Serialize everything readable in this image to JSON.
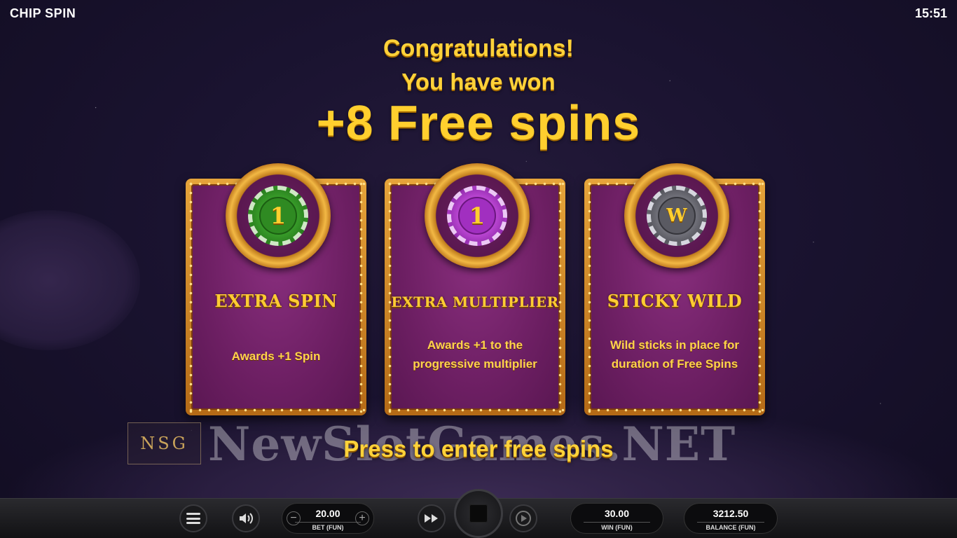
{
  "app": {
    "title": "CHIP SPIN",
    "clock": "15:51"
  },
  "headline": {
    "line1": "Congratulations!",
    "line2": "You have won",
    "line3": "+8 Free spins"
  },
  "cards": [
    {
      "chip_symbol": "1",
      "chip_icon": "green-chip-icon",
      "title": "EXTRA SPIN",
      "description": "Awards +1 Spin"
    },
    {
      "chip_symbol": "1",
      "chip_icon": "purple-chip-icon",
      "title": "EXTRA MULTIPLIER",
      "description": "Awards +1 to the progressive multiplier"
    },
    {
      "chip_symbol": "W",
      "chip_icon": "grey-wild-chip-icon",
      "title": "STICKY WILD",
      "description": "Wild sticks in place for duration of Free Spins"
    }
  ],
  "watermark": {
    "logo": "NSG",
    "text": "NewSlotGames.NET"
  },
  "prompt": "Press to enter free spins",
  "bottom_bar": {
    "bet": {
      "value": "20.00",
      "label": "BET (FUN)",
      "minus": "−",
      "plus": "+"
    },
    "win": {
      "value": "30.00",
      "label": "WIN (FUN)"
    },
    "balance": {
      "value": "3212.50",
      "label": "BALANCE (FUN)"
    },
    "icons": [
      "menu-icon",
      "sound-icon",
      "fast-forward-icon",
      "stop-icon",
      "autoplay-icon"
    ]
  },
  "colors": {
    "gold": "#ffd23a",
    "card_purple": "#6d1f63",
    "frame_gold": "#e6a43a"
  }
}
